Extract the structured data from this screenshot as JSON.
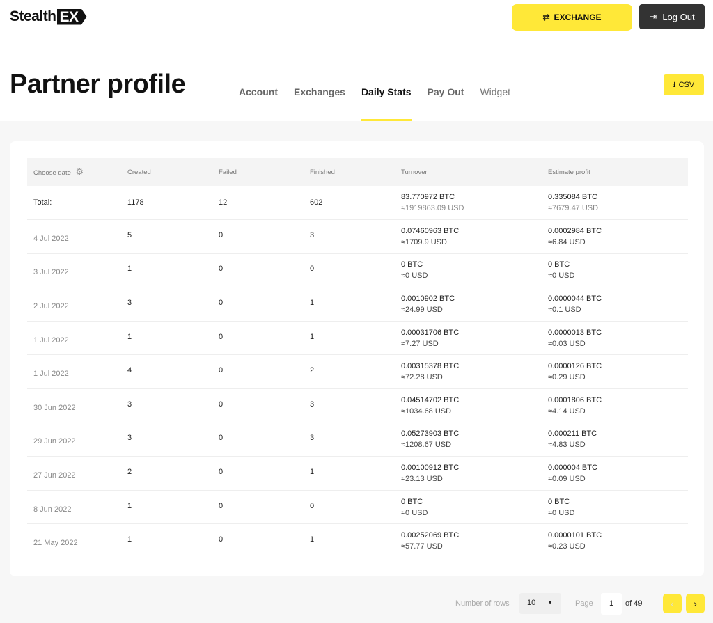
{
  "header": {
    "logo_text": "Stealth",
    "logo_mark": "EX",
    "exchange_label": "EXCHANGE",
    "logout_label": "Log Out"
  },
  "page": {
    "title": "Partner profile",
    "csv_label": "CSV"
  },
  "tabs": [
    {
      "label": "Account"
    },
    {
      "label": "Exchanges"
    },
    {
      "label": "Daily Stats",
      "active": true
    },
    {
      "label": "Pay Out"
    },
    {
      "label": "Widget"
    }
  ],
  "table": {
    "columns": [
      "Choose date",
      "Created",
      "Failed",
      "Finished",
      "Turnover",
      "Estimate profit"
    ],
    "total": {
      "date": "Total:",
      "created": "1178",
      "failed": "12",
      "finished": "602",
      "turnover_btc": "83.770972 BTC",
      "turnover_usd": "≈1919863.09 USD",
      "profit_btc": "0.335084 BTC",
      "profit_usd": "≈7679.47 USD"
    },
    "rows": [
      {
        "date": "4 Jul 2022",
        "created": "5",
        "failed": "0",
        "finished": "3",
        "turnover_btc": "0.07460963 BTC",
        "turnover_usd": "≈1709.9 USD",
        "profit_btc": "0.0002984 BTC",
        "profit_usd": "≈6.84 USD"
      },
      {
        "date": "3 Jul 2022",
        "created": "1",
        "failed": "0",
        "finished": "0",
        "turnover_btc": "0 BTC",
        "turnover_usd": "≈0 USD",
        "profit_btc": "0 BTC",
        "profit_usd": "≈0 USD"
      },
      {
        "date": "2 Jul 2022",
        "created": "3",
        "failed": "0",
        "finished": "1",
        "turnover_btc": "0.0010902 BTC",
        "turnover_usd": "≈24.99 USD",
        "profit_btc": "0.0000044 BTC",
        "profit_usd": "≈0.1 USD"
      },
      {
        "date": "1 Jul 2022",
        "created": "1",
        "failed": "0",
        "finished": "1",
        "turnover_btc": "0.00031706 BTC",
        "turnover_usd": "≈7.27 USD",
        "profit_btc": "0.0000013 BTC",
        "profit_usd": "≈0.03 USD"
      },
      {
        "date": "1 Jul 2022",
        "created": "4",
        "failed": "0",
        "finished": "2",
        "turnover_btc": "0.00315378 BTC",
        "turnover_usd": "≈72.28 USD",
        "profit_btc": "0.0000126 BTC",
        "profit_usd": "≈0.29 USD"
      },
      {
        "date": "30 Jun 2022",
        "created": "3",
        "failed": "0",
        "finished": "3",
        "turnover_btc": "0.04514702 BTC",
        "turnover_usd": "≈1034.68 USD",
        "profit_btc": "0.0001806 BTC",
        "profit_usd": "≈4.14 USD"
      },
      {
        "date": "29 Jun 2022",
        "created": "3",
        "failed": "0",
        "finished": "3",
        "turnover_btc": "0.05273903 BTC",
        "turnover_usd": "≈1208.67 USD",
        "profit_btc": "0.000211 BTC",
        "profit_usd": "≈4.83 USD"
      },
      {
        "date": "27 Jun 2022",
        "created": "2",
        "failed": "0",
        "finished": "1",
        "turnover_btc": "0.00100912 BTC",
        "turnover_usd": "≈23.13 USD",
        "profit_btc": "0.000004 BTC",
        "profit_usd": "≈0.09 USD"
      },
      {
        "date": "8 Jun 2022",
        "created": "1",
        "failed": "0",
        "finished": "0",
        "turnover_btc": "0 BTC",
        "turnover_usd": "≈0 USD",
        "profit_btc": "0 BTC",
        "profit_usd": "≈0 USD"
      },
      {
        "date": "21 May 2022",
        "created": "1",
        "failed": "0",
        "finished": "1",
        "turnover_btc": "0.00252069 BTC",
        "turnover_usd": "≈57.77 USD",
        "profit_btc": "0.0000101 BTC",
        "profit_usd": "≈0.23 USD"
      }
    ]
  },
  "pagination": {
    "rows_label": "Number of rows",
    "rows_value": "10",
    "page_label": "Page",
    "page_value": "1",
    "of_label": "of 49"
  },
  "colors": {
    "accent": "#ffe838",
    "dark": "#333333"
  }
}
